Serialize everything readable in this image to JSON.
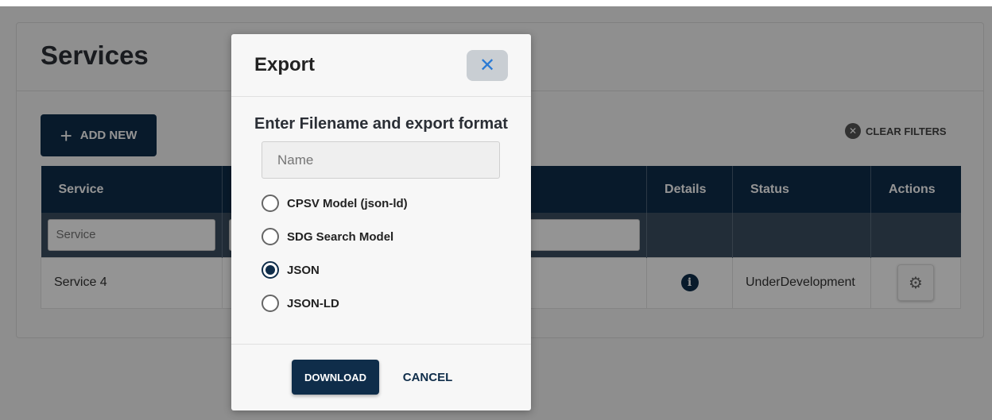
{
  "page": {
    "title": "Services",
    "add_new_label": "ADD NEW",
    "clear_filters_label": "CLEAR FILTERS"
  },
  "table": {
    "columns": [
      "Service",
      "",
      "Details",
      "Status",
      "Actions"
    ],
    "filter_placeholder_service": "Service",
    "rows": [
      {
        "service": "Service 4",
        "status": "UnderDevelopment"
      }
    ]
  },
  "modal": {
    "title": "Export",
    "subtitle": "Enter Filename and export format",
    "name_placeholder": "Name",
    "options": [
      {
        "label": "CPSV Model (json-ld)",
        "checked": false
      },
      {
        "label": "SDG Search Model",
        "checked": false
      },
      {
        "label": "JSON",
        "checked": true
      },
      {
        "label": "JSON-LD",
        "checked": false
      }
    ],
    "download_label": "DOWNLOAD",
    "cancel_label": "CANCEL"
  },
  "icons": {
    "add": "plus-icon",
    "clear_filters": "close-circle-icon",
    "details": "info-icon",
    "actions": "gear-icon",
    "modal_close": "close-icon"
  },
  "colors": {
    "primary": "#0f2d4a",
    "filter_row": "#3b4f61",
    "close_accent": "#2a7ad4"
  }
}
